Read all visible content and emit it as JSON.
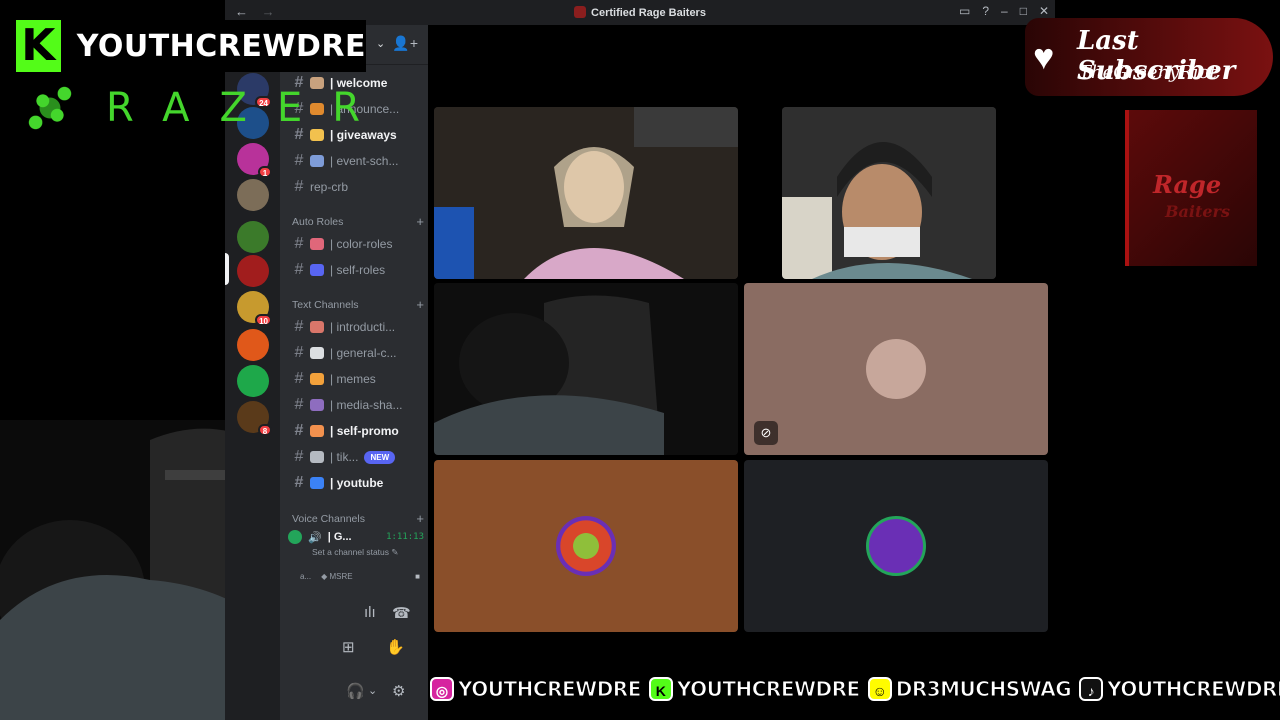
{
  "window": {
    "title": "Certified Rage Baiters",
    "nav_back": "←",
    "nav_forward": "→",
    "buttons": {
      "inbox": "▭",
      "help": "?",
      "minimize": "–",
      "maximize": "□",
      "close": "✕"
    }
  },
  "guilds": [
    {
      "color": "#2b3a67",
      "badge": "24"
    },
    {
      "color": "#1d4f8a",
      "badge": ""
    },
    {
      "color": "#b8329a",
      "badge": "1"
    },
    {
      "color": "#7c6d58",
      "badge": ""
    },
    {
      "color": "#3b7a2a",
      "badge": ""
    },
    {
      "color": "#a11d1d",
      "badge": ""
    },
    {
      "color": "#c79a2e",
      "badge": "10"
    },
    {
      "color": "#e0581a",
      "badge": ""
    },
    {
      "color": "#1ea84a",
      "badge": ""
    },
    {
      "color": "#5a3a1a",
      "badge": "8"
    }
  ],
  "channels": [
    {
      "name": "| welcome",
      "unread": true,
      "emoji": "#c9a27e"
    },
    {
      "name": "| announce...",
      "unread": false,
      "emoji": "#e08a2e"
    },
    {
      "name": "| giveaways",
      "unread": true,
      "emoji": "#f2c14e"
    },
    {
      "name": "| event-sch...",
      "unread": false,
      "emoji": "#7e9cd8"
    },
    {
      "name": "rep-crb",
      "unread": false,
      "emoji": ""
    }
  ],
  "categories": {
    "auto_roles": "Auto Roles",
    "text_channels": "Text Channels",
    "voice_channels": "Voice Channels"
  },
  "role_channels": [
    {
      "name": "| color-roles",
      "emoji": "#e0677a"
    },
    {
      "name": "| self-roles",
      "emoji": "#5865f2"
    }
  ],
  "text_channels": [
    {
      "name": "| introducti...",
      "unread": false,
      "emoji": "#d9766a",
      "new": false
    },
    {
      "name": "| general-c...",
      "unread": false,
      "emoji": "#dbdee1",
      "new": false
    },
    {
      "name": "| memes",
      "unread": false,
      "emoji": "#f2a13b",
      "new": false
    },
    {
      "name": "| media-sha...",
      "unread": false,
      "emoji": "#8e6dbf",
      "new": false
    },
    {
      "name": "| self-promo",
      "unread": true,
      "emoji": "#f2914e",
      "new": false
    },
    {
      "name": "| tik...",
      "unread": false,
      "emoji": "#b5bac1",
      "new": true
    },
    {
      "name": "| youtube",
      "unread": true,
      "emoji": "#3b82f6",
      "new": false
    }
  ],
  "new_badge": "NEW",
  "voice": {
    "channel": "| G...",
    "timer": "1:11:13",
    "status": "Set a channel status ✎",
    "user_short": "a...",
    "user_tag": "◆ MSRE"
  },
  "tiles": [
    {
      "bg": "#2e2a24",
      "avatar": ""
    },
    {
      "bg": "#3a3a3a",
      "avatar": ""
    },
    {
      "bg": "#2a2a2a",
      "avatar": ""
    },
    {
      "bg": "#8a6c62",
      "avatar": "#c7a79b"
    },
    {
      "bg": "#8a4f2a",
      "avatar": "#b8532a"
    },
    {
      "bg": "#1e2024",
      "avatar": "#6a2fb5"
    }
  ],
  "overlay": {
    "kick_letter": "K",
    "channel_name": "YOUTHCREWDRE",
    "razer_word": "RAZER",
    "last_subscriber_label": "Last Subscriber",
    "last_subscriber_name": "TheGreenyRiot",
    "poster_title": "Rage",
    "poster_sub": "Baiters"
  },
  "socials": [
    {
      "icon": "instagram-icon",
      "glyph": "◎",
      "color": "#d6249f",
      "handle": "YOUTHCREWDRE"
    },
    {
      "icon": "kick-icon",
      "glyph": "K",
      "color": "#53fc18",
      "handle": "YOUTHCREWDRE"
    },
    {
      "icon": "snapchat-icon",
      "glyph": "☺",
      "color": "#fffc00",
      "handle": "DR3MUCHSWAG"
    },
    {
      "icon": "tiktok-icon",
      "glyph": "♪",
      "color": "#111111",
      "handle": "YOUTHCREWDRE"
    }
  ]
}
